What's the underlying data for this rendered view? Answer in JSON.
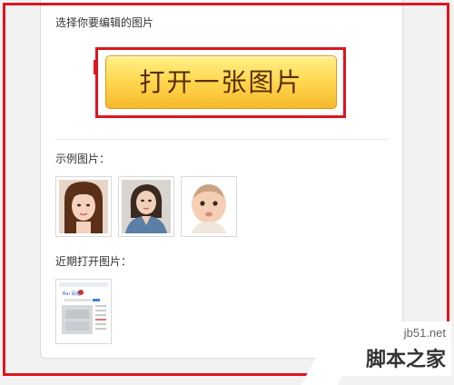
{
  "panel": {
    "choose_label": "选择你要编辑的图片",
    "open_button_label": "打开一张图片",
    "examples_label": "示例图片：",
    "recent_label": "近期打开图片："
  },
  "example_images": [
    {
      "name": "example-photo-woman-bangs"
    },
    {
      "name": "example-photo-woman-denim"
    },
    {
      "name": "example-photo-baby"
    }
  ],
  "recent_images": [
    {
      "name": "recent-baidu-screenshot",
      "logo_text": "Bai 百度"
    }
  ],
  "watermark": {
    "domain": "jb51.net",
    "site_name": "脚本之家"
  },
  "colors": {
    "highlight_red": "#e0141e",
    "button_yellow": "#ffd952",
    "button_text": "#5a2c00"
  }
}
